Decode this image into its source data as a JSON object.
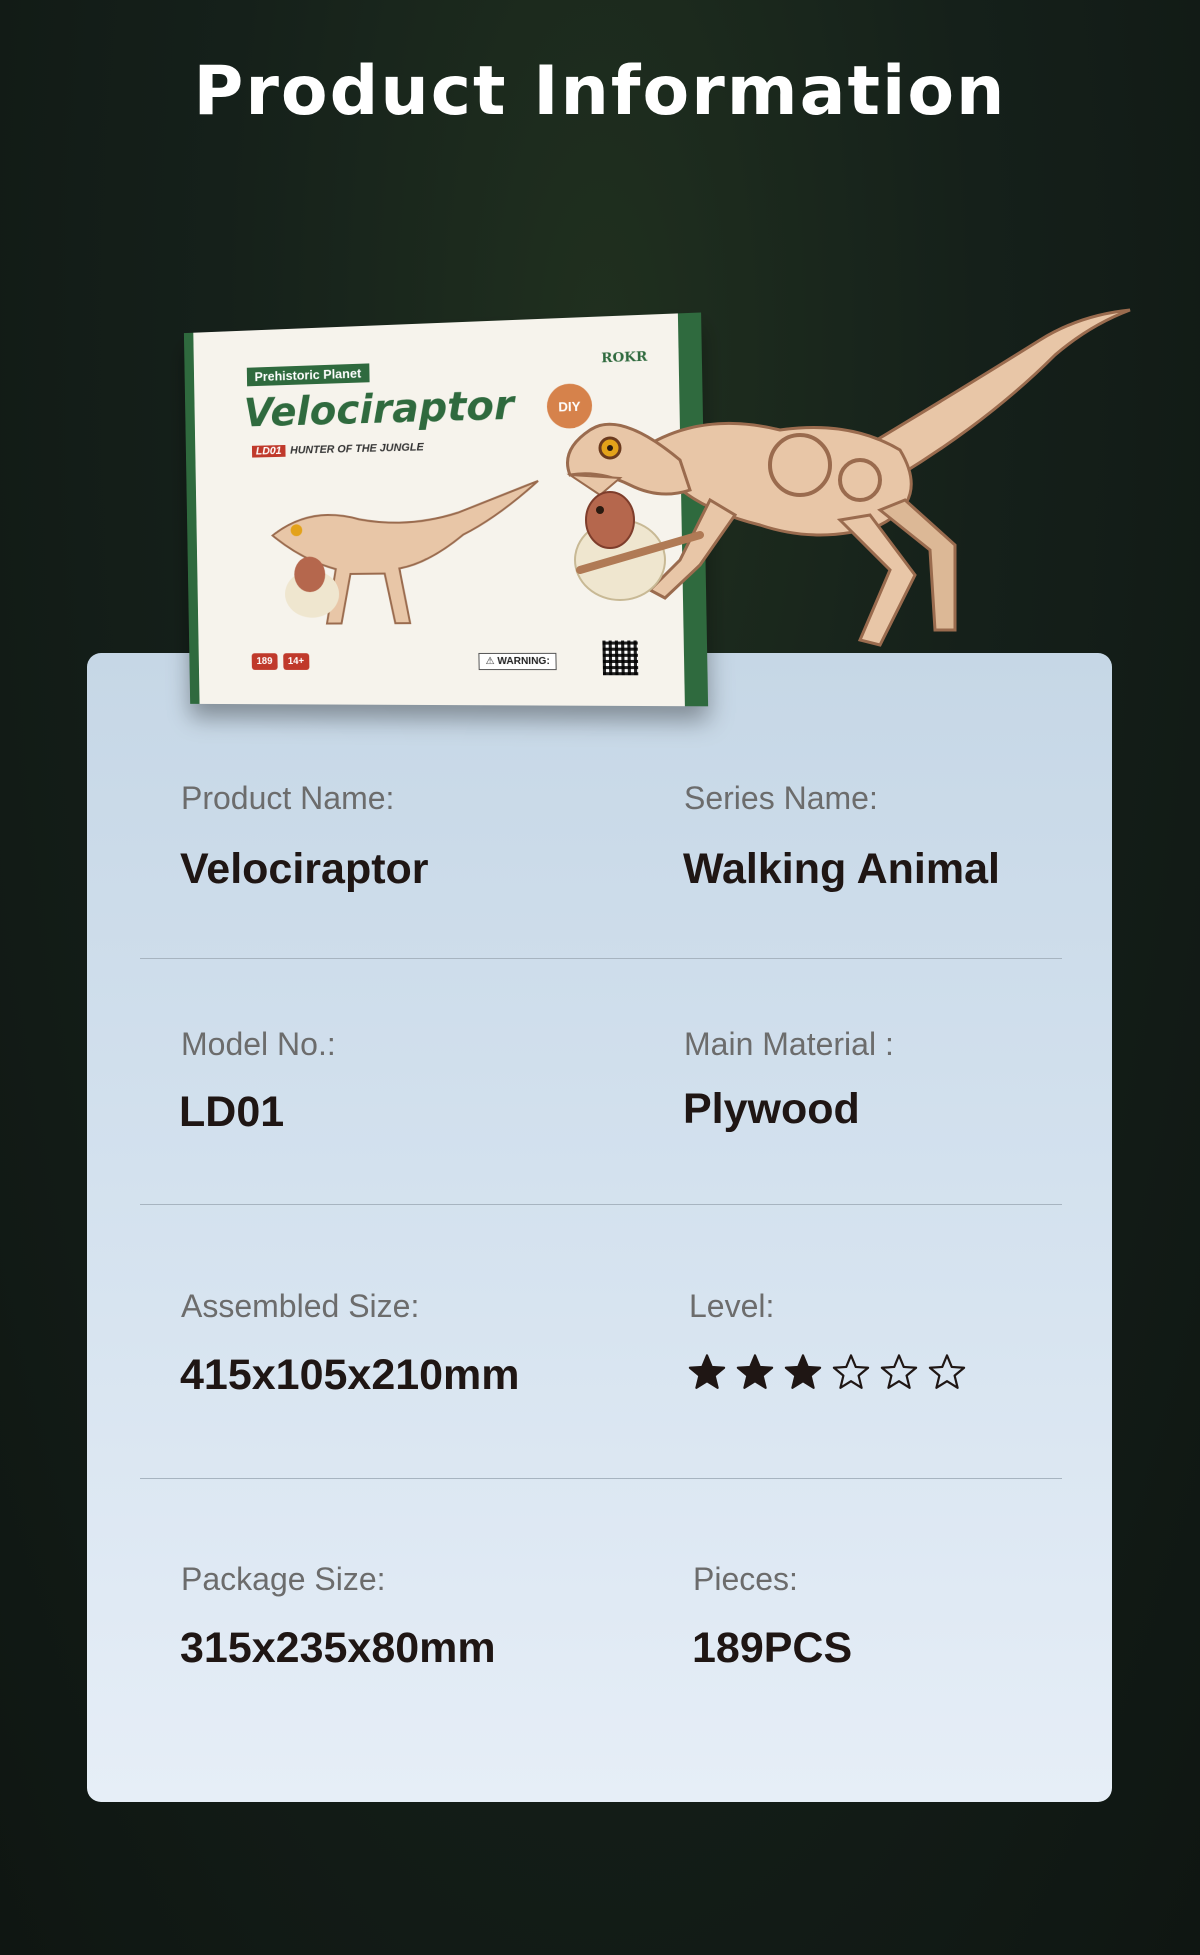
{
  "header": {
    "title": "Product Information"
  },
  "box": {
    "series": "Prehistoric Planet",
    "brand": "ROKR",
    "title": "Velociraptor",
    "code": "LD01",
    "subtitle": "HUNTER OF THE JUNGLE",
    "diy": "DIY",
    "badges": [
      "189",
      "14+"
    ],
    "warning": "⚠ WARNING:"
  },
  "specs": {
    "product_name": {
      "label": "Product Name:",
      "value": "Velociraptor"
    },
    "series_name": {
      "label": "Series Name:",
      "value": "Walking Animal"
    },
    "model_no": {
      "label": "Model No.:",
      "value": "LD01"
    },
    "main_material": {
      "label": "Main Material :",
      "value": "Plywood"
    },
    "assembled_size": {
      "label": "Assembled Size:",
      "value": "415x105x210mm"
    },
    "level": {
      "label": "Level:",
      "rating": 3,
      "max": 6
    },
    "package_size": {
      "label": "Package Size:",
      "value": "315x235x80mm"
    },
    "pieces": {
      "label": "Pieces:",
      "value": "189PCS"
    }
  },
  "colors": {
    "background": "#15201a",
    "card_top": "#c6d7e6",
    "card_bottom": "#e6eef7",
    "box_green": "#2f6a3e",
    "wood": "#e8c6a7"
  }
}
